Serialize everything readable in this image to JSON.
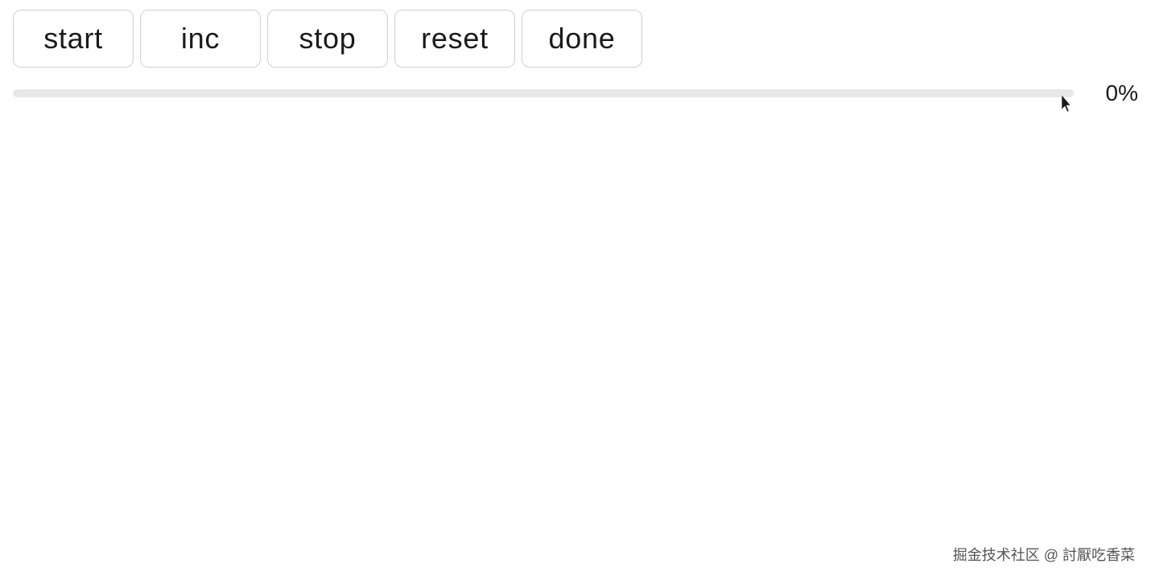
{
  "toolbar": {
    "buttons": [
      {
        "id": "start",
        "label": "start"
      },
      {
        "id": "inc",
        "label": "inc"
      },
      {
        "id": "stop",
        "label": "stop"
      },
      {
        "id": "reset",
        "label": "reset"
      },
      {
        "id": "done",
        "label": "done"
      }
    ]
  },
  "progress": {
    "value": 0,
    "label": "0%"
  },
  "watermark": {
    "text": "掘金技术社区 @ 討厭吃香菜"
  }
}
